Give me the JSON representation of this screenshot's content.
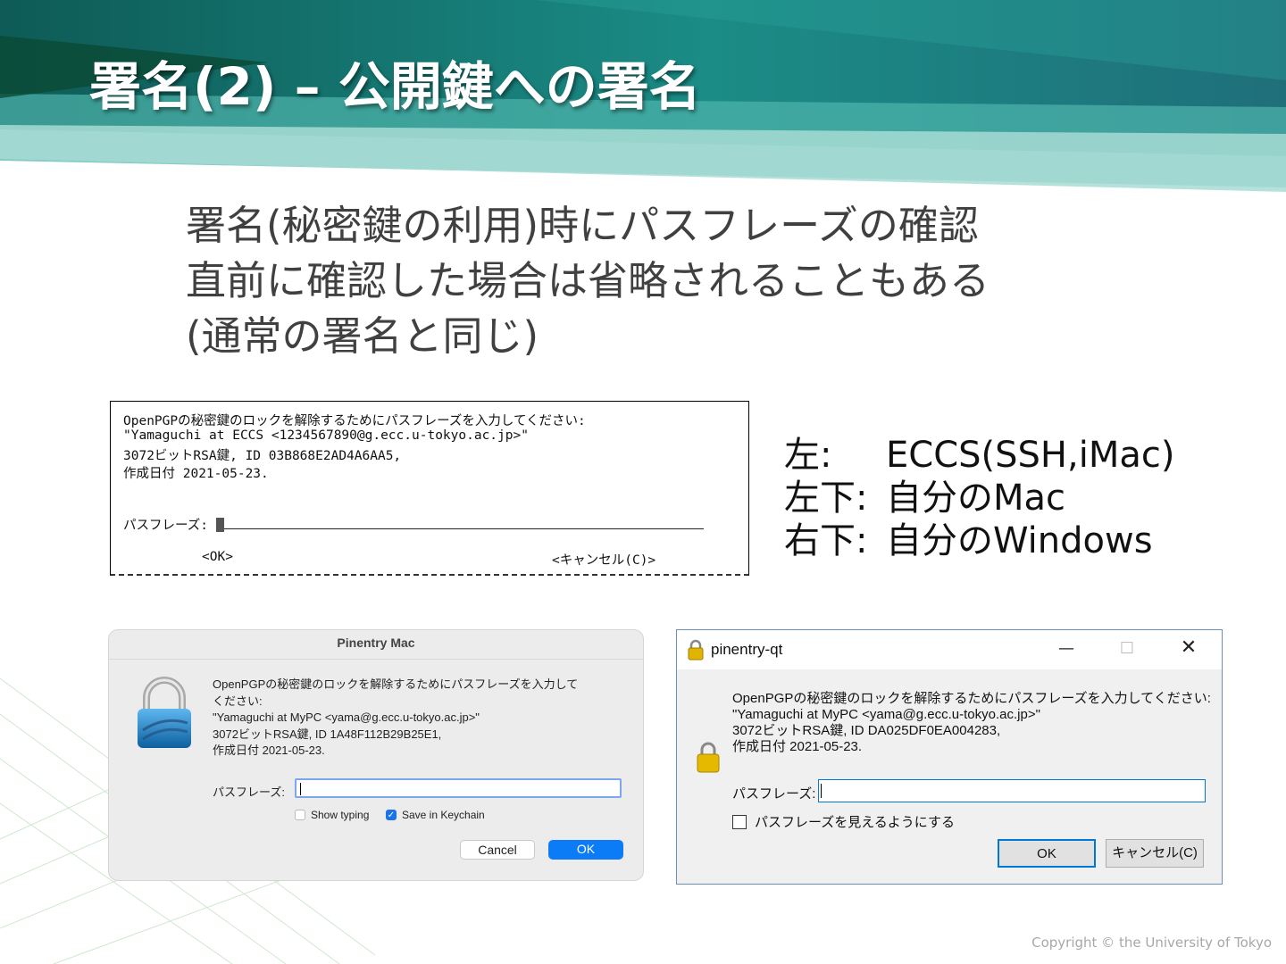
{
  "slide": {
    "title": "署名(2) – 公開鍵への署名",
    "bullets": [
      "署名(秘密鍵の利用)時にパスフレーズの確認",
      "直前に確認した場合は省略されることもある",
      "(通常の署名と同じ)"
    ],
    "legend": [
      {
        "key": "左:",
        "value": "ECCS(SSH,iMac)"
      },
      {
        "key": "左下:",
        "value": "自分のMac"
      },
      {
        "key": "右下:",
        "value": "自分のWindows"
      }
    ],
    "footer": "Copyright © the University of Tokyo"
  },
  "terminal": {
    "lines": [
      "OpenPGPの秘密鍵のロックを解除するためにパスフレーズを入力してください:",
      "\"Yamaguchi at ECCS <1234567890@g.ecc.u-tokyo.ac.jp>\"",
      "3072ビットRSA鍵, ID 03B868E2AD4A6AA5,",
      "作成日付 2021-05-23."
    ],
    "passphrase_label": "パスフレーズ:",
    "ok_label": "<OK>",
    "cancel_label": "<キャンセル(C)>"
  },
  "mac_dialog": {
    "title": "Pinentry Mac",
    "message": [
      "OpenPGPの秘密鍵のロックを解除するためにパスフレーズを入力して",
      "ください:",
      "\"Yamaguchi at MyPC <yama@g.ecc.u-tokyo.ac.jp>\"",
      "3072ビットRSA鍵, ID 1A48F112B29B25E1,",
      "作成日付 2021-05-23."
    ],
    "passphrase_label": "パスフレーズ:",
    "show_typing_label": "Show typing",
    "save_keychain_label": "Save in Keychain",
    "cancel_label": "Cancel",
    "ok_label": "OK",
    "accent": "#0b7cf5"
  },
  "win_dialog": {
    "title": "pinentry-qt",
    "message": [
      "OpenPGPの秘密鍵のロックを解除するためにパスフレーズを入力してください:",
      "\"Yamaguchi at MyPC <yama@g.ecc.u-tokyo.ac.jp>\"",
      "3072ビットRSA鍵, ID DA025DF0EA004283,",
      "作成日付 2021-05-23."
    ],
    "passphrase_label": "パスフレーズ:",
    "show_passphrase_label": "パスフレーズを見えるようにする",
    "ok_label": "OK",
    "cancel_label": "キャンセル(C)",
    "icons": [
      "lock-icon",
      "minimize-icon",
      "maximize-icon",
      "close-icon"
    ]
  }
}
